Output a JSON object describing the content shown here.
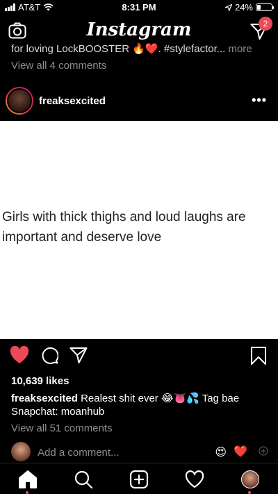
{
  "status_bar": {
    "carrier": "AT&T",
    "time": "8:31 PM",
    "battery": "24%",
    "battery_level": 0.24,
    "icons": [
      "signal-bars-icon",
      "wifi-icon",
      "location-arrow-icon",
      "battery-icon"
    ]
  },
  "topbar": {
    "logo": "Instagram",
    "direct_badge": "2",
    "icons": [
      "camera-icon",
      "direct-message-icon"
    ]
  },
  "previous_post": {
    "caption_partial": "for loving LockBOOSTER 🔥❤️. #stylefactor...",
    "more_label": "more",
    "view_comments": "View all 4 comments"
  },
  "post": {
    "username": "freaksexcited",
    "image_text": "Girls with thick thighs and loud laughs are important and deserve love",
    "likes": "10,639 likes",
    "caption_user": "freaksexcited",
    "caption_text": "Realest shit ever 😂👅💦 Tag bae Snapchat: moanhub",
    "view_comments": "View all 51 comments",
    "add_comment_placeholder": "Add a comment...",
    "quick_emojis": [
      "😍",
      "❤️"
    ],
    "liked": true
  },
  "colors": {
    "like_red": "#ed4956",
    "muted_text": "#8e8e8e",
    "background": "#000000"
  },
  "tabbar": {
    "tabs": [
      "home-icon",
      "search-icon",
      "new-post-icon",
      "activity-heart-icon",
      "profile-avatar"
    ],
    "active": "home-icon"
  }
}
